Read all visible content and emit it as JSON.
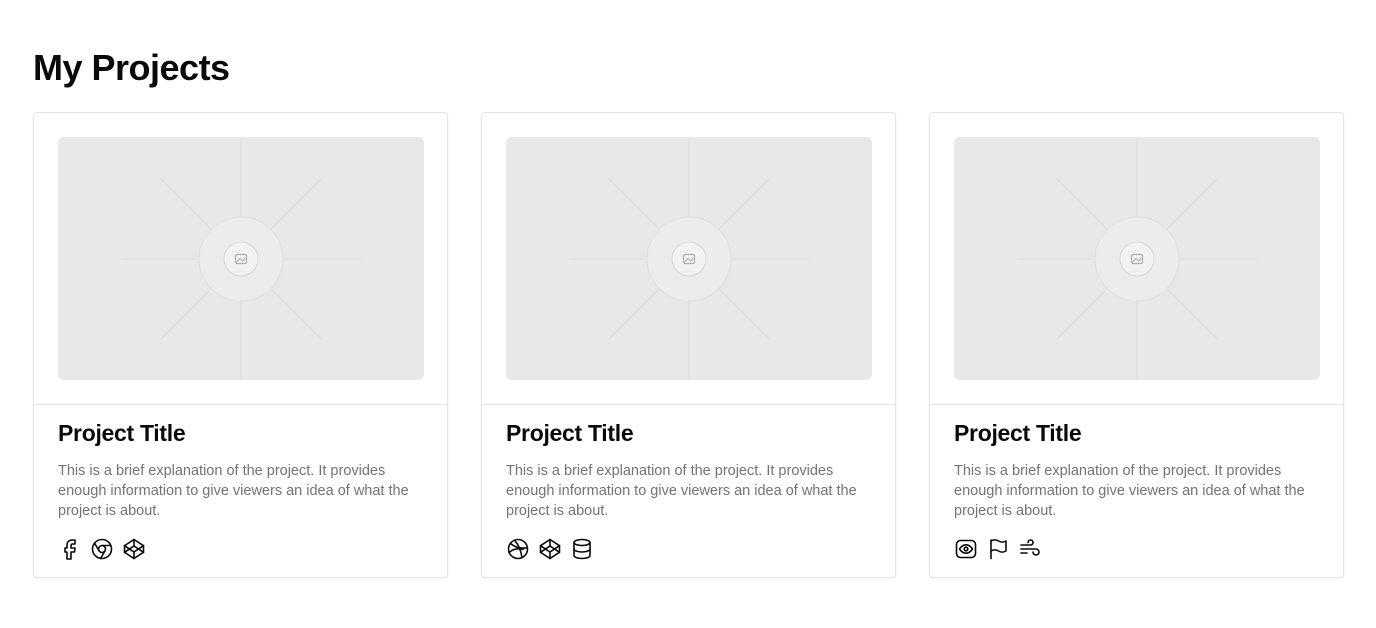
{
  "page": {
    "title": "My Projects"
  },
  "projects": [
    {
      "title": "Project Title",
      "description": "This is a brief explanation of the project. It provides enough information to give viewers an idea of what the project is about.",
      "icons": [
        "facebook-icon",
        "chrome-icon",
        "codepen-icon"
      ]
    },
    {
      "title": "Project Title",
      "description": "This is a brief explanation of the project. It provides enough information to give viewers an idea of what the project is about.",
      "icons": [
        "dribbble-icon",
        "codepen-icon",
        "database-icon"
      ]
    },
    {
      "title": "Project Title",
      "description": "This is a brief explanation of the project. It provides enough information to give viewers an idea of what the project is about.",
      "icons": [
        "eye-icon",
        "flag-icon",
        "wind-icon"
      ]
    }
  ],
  "colors": {
    "text": "#0a0a0a",
    "muted_text": "#737373",
    "border": "#e6e6e6",
    "placeholder_bg": "#e8e8e8"
  }
}
